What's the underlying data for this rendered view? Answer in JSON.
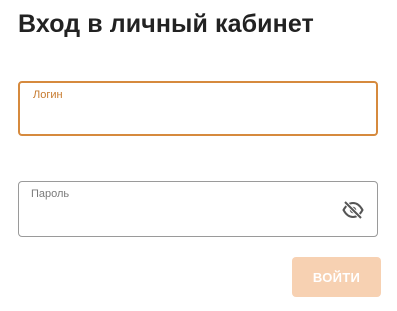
{
  "page": {
    "title": "Вход в личный кабинет"
  },
  "login_field": {
    "label": "Логин",
    "value": ""
  },
  "password_field": {
    "label": "Пароль",
    "value": "",
    "toggle_icon": "eye-off-icon"
  },
  "submit": {
    "label": "войти",
    "state": "disabled"
  },
  "colors": {
    "accent": "#d68a3e",
    "accent_label": "#c77a2e",
    "button_disabled": "#f7d1b2",
    "title": "#222222",
    "border_inactive": "#9a9a9a"
  }
}
